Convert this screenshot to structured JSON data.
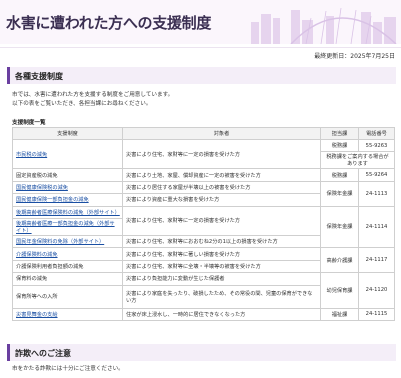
{
  "header": {
    "title": "水害に遭われた方への支援制度"
  },
  "updated": "最終更新日：2025年7月25日",
  "section1": {
    "title": "各種支援制度"
  },
  "intro": [
    "市では、水害に遭われた方を支援する制度をご用意しています。",
    "以下の表をご覧いただき、各担当課にお尋ねください。"
  ],
  "table": {
    "title": "支援制度一覧",
    "headers": [
      "支援制度",
      "対象者",
      "担当課",
      "電話番号"
    ],
    "rows": [
      {
        "name": "市民税の減免",
        "target": "災害により住宅、家財等に一定の損害を受けた方",
        "dept": "税務課",
        "phone": "55-9263",
        "note": "税務課をご案内する場合があります"
      },
      {
        "name": "固定資産税の減免",
        "target": "災害により土地、家屋、償却資産に一定の被害を受けた方",
        "dept": "税務課",
        "phone": "55-9264"
      },
      {
        "name": "国民健康保険税の減免",
        "target": "災害により居住する家屋が半壊以上の被害を受けた方",
        "dept": "保険年金課",
        "phone": "24-1113"
      },
      {
        "name": "国民健康保険一部負担金の減免",
        "target": "災害により資産に重大な損害を受けた方",
        "dept": "",
        "phone": ""
      },
      {
        "name": "後期高齢者医療保険料の減免（外部サイト）",
        "target": "災害により住宅、家財等に一定の損害を受けた方",
        "dept": "保険年金課",
        "phone": "24-1114"
      },
      {
        "name": "後期高齢者医療一部負担金の減免（外部サイト）",
        "target": "",
        "dept": "",
        "phone": ""
      },
      {
        "name": "国民年金保険料の免除（外部サイト）",
        "target": "災害により住宅、家財等におおむね2分の1以上の損害を受けた方",
        "dept": "",
        "phone": ""
      },
      {
        "name": "介護保険料の減免",
        "target": "災害により住宅、家財等に著しい損害を受けた方",
        "dept": "高齢介護課",
        "phone": "24-1117"
      },
      {
        "name": "介護保険利用者負担額の減免",
        "target": "災害により住宅、家財等に全壊・半壊等の被害を受けた方",
        "dept": "",
        "phone": ""
      },
      {
        "name": "保育料の減免",
        "target": "災害により負担能力に変動が生じた保護者",
        "dept": "幼児保育課",
        "phone": "24-1120"
      },
      {
        "name": "保育所等への入所",
        "target": "災害により家庭を失ったり、破損したため、その常役の間、児童の保育ができない方",
        "dept": "",
        "phone": ""
      },
      {
        "name": "災害見舞金の支給",
        "target": "住家が床上浸水し、一時的に居住できなくなった方",
        "dept": "福祉課",
        "phone": "24-1115"
      }
    ]
  },
  "section2": {
    "title": "詐欺へのご注意"
  },
  "note": "市をかたる詐欺には十分にご注意ください。"
}
